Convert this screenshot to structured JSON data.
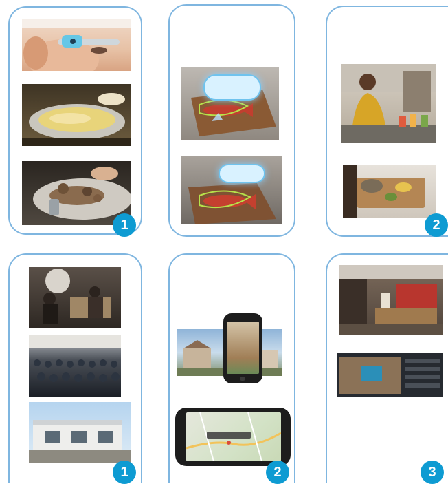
{
  "badges": {
    "card1": "1",
    "card2": "2",
    "card3": "1",
    "card4": "2",
    "card5": "3"
  }
}
